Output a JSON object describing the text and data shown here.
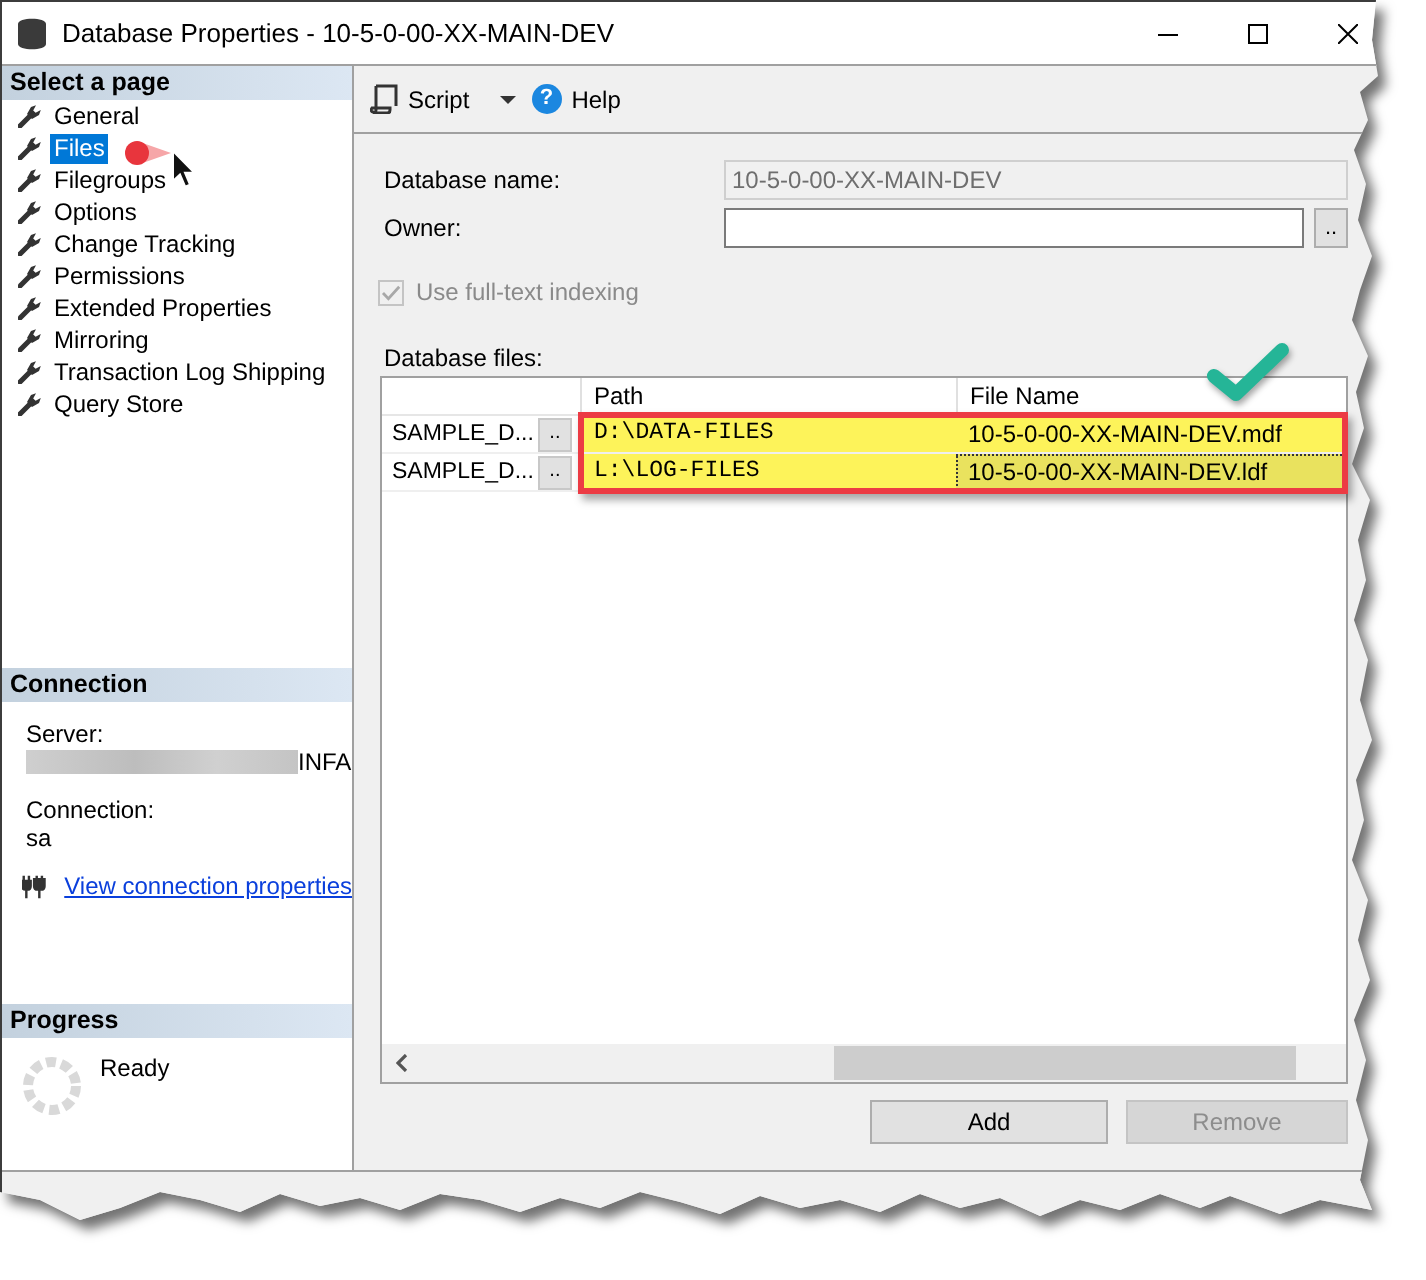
{
  "window": {
    "title": "Database Properties - 10-5-0-00-XX-MAIN-DEV"
  },
  "sidebar": {
    "header": "Select a page",
    "items": [
      {
        "label": "General",
        "selected": false
      },
      {
        "label": "Files",
        "selected": true
      },
      {
        "label": "Filegroups",
        "selected": false
      },
      {
        "label": "Options",
        "selected": false
      },
      {
        "label": "Change Tracking",
        "selected": false
      },
      {
        "label": "Permissions",
        "selected": false
      },
      {
        "label": "Extended Properties",
        "selected": false
      },
      {
        "label": "Mirroring",
        "selected": false
      },
      {
        "label": "Transaction Log Shipping",
        "selected": false
      },
      {
        "label": "Query Store",
        "selected": false
      }
    ]
  },
  "connection": {
    "header": "Connection",
    "server": {
      "label": "Server:",
      "value": "INFA",
      "redacted": true
    },
    "login": {
      "label": "Connection:",
      "value": "sa"
    },
    "link": "View connection properties"
  },
  "progress": {
    "header": "Progress",
    "status": "Ready"
  },
  "toolbar": {
    "items": [
      {
        "kind": "script",
        "label": "Script"
      },
      {
        "kind": "help",
        "label": "Help",
        "icon_glyph": "?"
      }
    ]
  },
  "form": {
    "database_name": {
      "label": "Database name:",
      "value": "10-5-0-00-XX-MAIN-DEV",
      "disabled": true
    },
    "owner": {
      "label": "Owner:",
      "browse_label": ".."
    },
    "full_text_indexing": {
      "label": "Use full-text indexing",
      "checked": true,
      "disabled": true
    }
  },
  "database_files": {
    "label": "Database files:",
    "columns": [
      "Path",
      "File Name"
    ],
    "rows": [
      {
        "column_1": "SAMPLE_D...",
        "button": "..",
        "path": "D:\\DATA-FILES",
        "file_name": "10-5-0-00-XX-MAIN-DEV.mdf",
        "highlighted": true,
        "focused": false
      },
      {
        "column_1": "SAMPLE_D...",
        "button": "..",
        "path": "L:\\LOG-FILES",
        "file_name": "10-5-0-00-XX-MAIN-DEV.ldf",
        "highlighted": true,
        "focused": true
      }
    ]
  },
  "buttons": [
    {
      "label": "Add",
      "disabled": false
    },
    {
      "label": "Remove",
      "disabled": true
    }
  ],
  "annotations": {
    "click_cursor": true,
    "checkmark": true
  }
}
